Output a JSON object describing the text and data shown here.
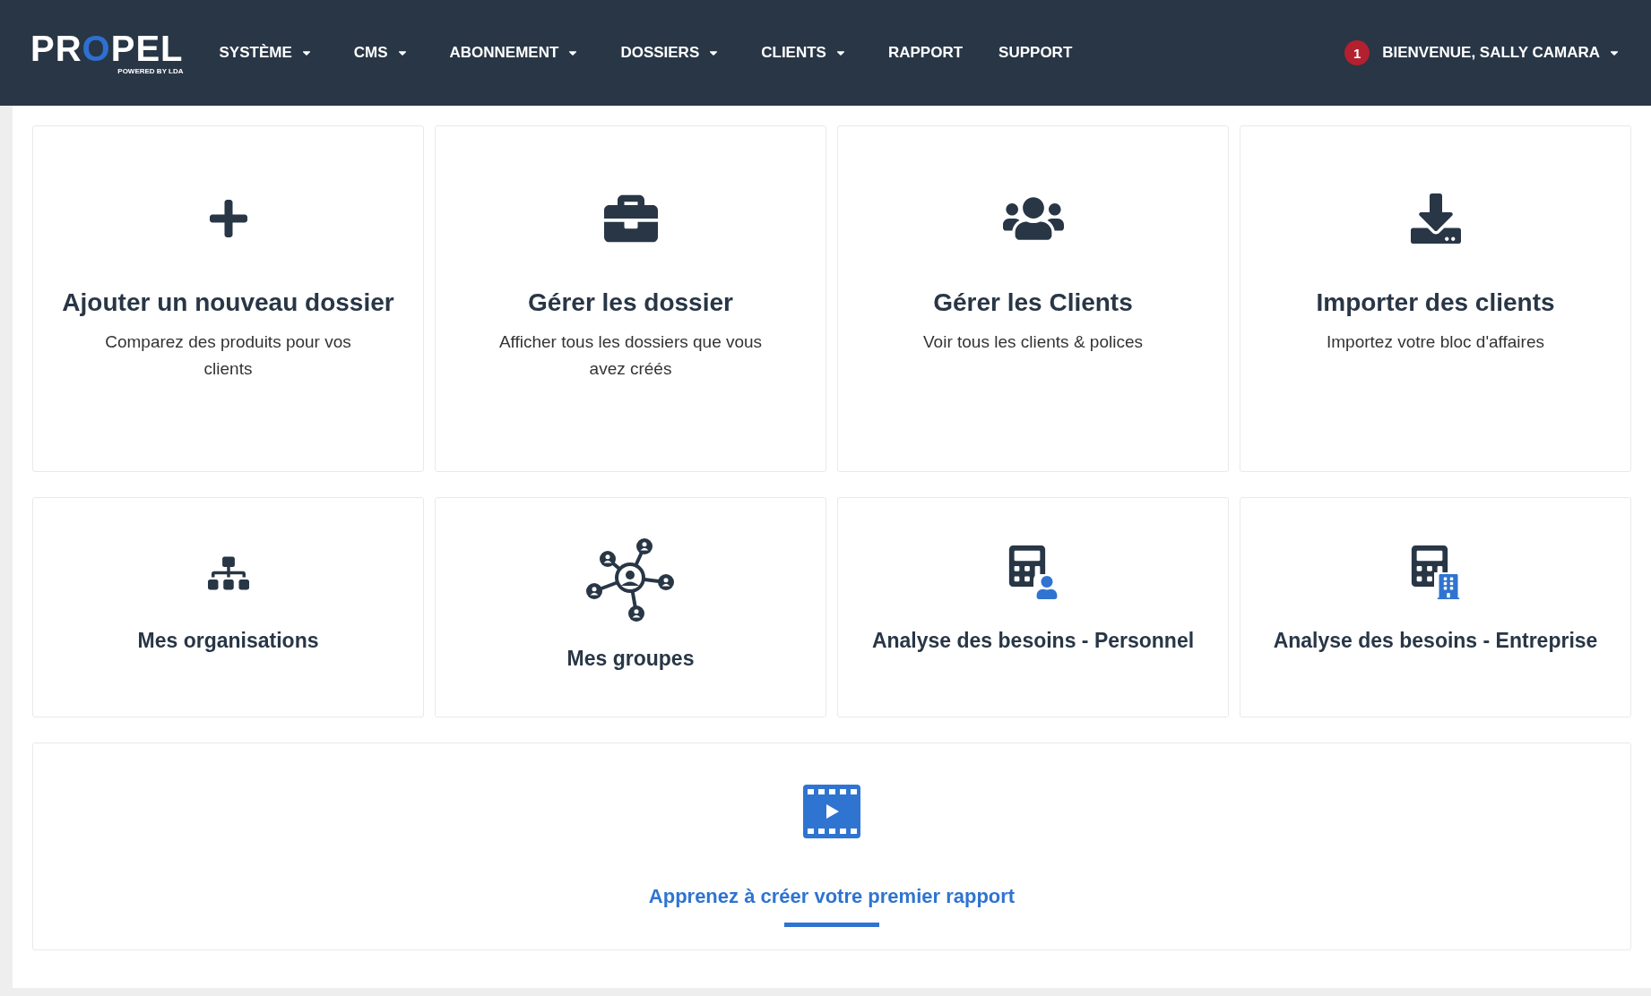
{
  "logo": {
    "name": "PROPEL",
    "tagline": "POWERED BY LDA"
  },
  "nav": [
    {
      "label": "SYSTÈME",
      "dropdown": true
    },
    {
      "label": "CMS",
      "dropdown": true
    },
    {
      "label": "ABONNEMENT",
      "dropdown": true
    },
    {
      "label": "DOSSIERS",
      "dropdown": true
    },
    {
      "label": "CLIENTS",
      "dropdown": true
    },
    {
      "label": "RAPPORT",
      "dropdown": false
    },
    {
      "label": "SUPPORT",
      "dropdown": false
    }
  ],
  "user": {
    "notifications": "1",
    "greeting": "BIENVENUE, SALLY CAMARA"
  },
  "cards": [
    {
      "kind": "plus",
      "title": "Ajouter un nouveau dossier",
      "description": "Comparez des produits pour vos clients"
    },
    {
      "kind": "briefcase",
      "title": "Gérer les dossier",
      "description": "Afficher tous les dossiers que vous avez créés"
    },
    {
      "kind": "users",
      "title": "Gérer les Clients",
      "description": "Voir tous les clients & polices"
    },
    {
      "kind": "download",
      "title": "Importer des clients",
      "description": "Importez votre bloc d'affaires"
    },
    {
      "kind": "sitemap",
      "title": "Mes organisations"
    },
    {
      "kind": "network",
      "title": "Mes groupes"
    },
    {
      "kind": "calc-person",
      "title": "Analyse des besoins - Personnel"
    },
    {
      "kind": "calc-building",
      "title": "Analyse des besoins - Entreprise"
    }
  ],
  "tutorial": {
    "link": "Apprenez à créer votre premier rapport"
  }
}
